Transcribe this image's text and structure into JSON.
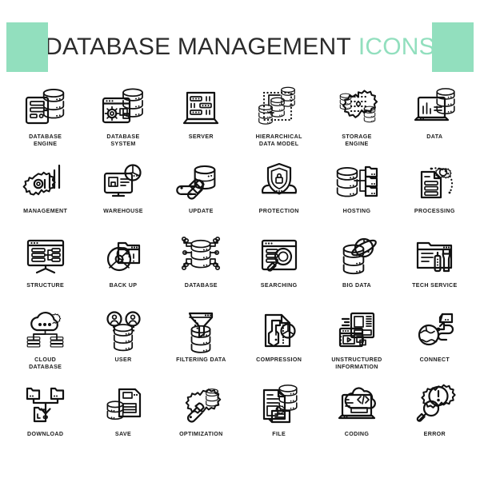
{
  "header": {
    "title_main": "DATABASE MANAGEMENT",
    "title_accent": "ICONS",
    "accent_color": "#92dfbe",
    "title_color": "#2b2b2b"
  },
  "icons": [
    {
      "id": "database-engine",
      "label": "DATABASE\nENGINE"
    },
    {
      "id": "database-system",
      "label": "DATABASE\nSYSTEM"
    },
    {
      "id": "server",
      "label": "SERVER"
    },
    {
      "id": "hierarchical-data-model",
      "label": "HIERARCHICAL\nDATA MODEL"
    },
    {
      "id": "storage-engine",
      "label": "STORAGE\nENGINE"
    },
    {
      "id": "data",
      "label": "DATA"
    },
    {
      "id": "management",
      "label": "MANAGEMENT"
    },
    {
      "id": "warehouse",
      "label": "WAREHOUSE"
    },
    {
      "id": "update",
      "label": "UPDATE"
    },
    {
      "id": "protection",
      "label": "PROTECTION"
    },
    {
      "id": "hosting",
      "label": "HOSTING"
    },
    {
      "id": "processing",
      "label": "PROCESSING"
    },
    {
      "id": "structure",
      "label": "STRUCTURE"
    },
    {
      "id": "back-up",
      "label": "BACK UP"
    },
    {
      "id": "database",
      "label": "DATABASE"
    },
    {
      "id": "searching",
      "label": "SEARCHING"
    },
    {
      "id": "big-data",
      "label": "BIG DATA"
    },
    {
      "id": "tech-service",
      "label": "TECH SERVICE"
    },
    {
      "id": "cloud-database",
      "label": "CLOUD\nDATABASE"
    },
    {
      "id": "user",
      "label": "USER"
    },
    {
      "id": "filtering-data",
      "label": "FILTERING DATA"
    },
    {
      "id": "compression",
      "label": "COMPRESSION"
    },
    {
      "id": "unstructured-information",
      "label": "UNSTRUCTURED\nINFORMATION"
    },
    {
      "id": "connect",
      "label": "CONNECT"
    },
    {
      "id": "download",
      "label": "DOWNLOAD"
    },
    {
      "id": "save",
      "label": "SAVE"
    },
    {
      "id": "optimization",
      "label": "OPTIMIZATION"
    },
    {
      "id": "file",
      "label": "FILE"
    },
    {
      "id": "coding",
      "label": "CODING"
    },
    {
      "id": "error",
      "label": "ERROR"
    }
  ]
}
